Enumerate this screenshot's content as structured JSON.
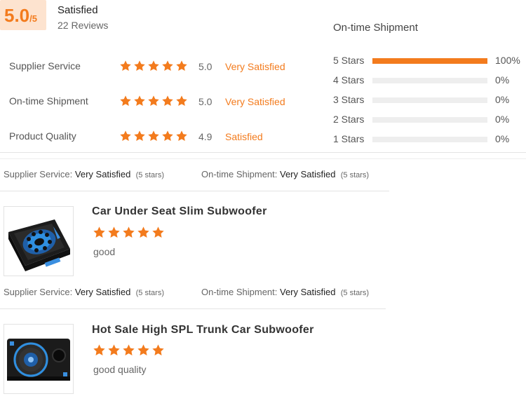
{
  "summary": {
    "score": "5.0",
    "score_out_of": "/5",
    "label": "Satisfied",
    "reviews": "22 Reviews"
  },
  "metrics": [
    {
      "label": "Supplier Service",
      "stars": 5,
      "score": "5.0",
      "text": "Very Satisfied"
    },
    {
      "label": "On-time Shipment",
      "stars": 5,
      "score": "5.0",
      "text": "Very Satisfied"
    },
    {
      "label": "Product Quality",
      "stars": 5,
      "score": "4.9",
      "text": "Satisfied"
    }
  ],
  "distribution": {
    "title": "On-time Shipment",
    "rows": [
      {
        "label": "5 Stars",
        "fraction": 1.0,
        "pct": "100%"
      },
      {
        "label": "4 Stars",
        "fraction": 0.0,
        "pct": "0%"
      },
      {
        "label": "3 Stars",
        "fraction": 0.0,
        "pct": "0%"
      },
      {
        "label": "2 Stars",
        "fraction": 0.0,
        "pct": "0%"
      },
      {
        "label": "1 Stars",
        "fraction": 0.0,
        "pct": "0%"
      }
    ]
  },
  "reviews": [
    {
      "supplier_label": "Supplier Service:",
      "supplier_value": "Very Satisfied",
      "supplier_stars": "(5 stars)",
      "shipment_label": "On-time Shipment:",
      "shipment_value": "Very Satisfied",
      "shipment_stars": "(5 stars)",
      "product_title": "Car Under Seat Slim Subwoofer",
      "stars": 5,
      "text": "good"
    },
    {
      "supplier_label": "Supplier Service:",
      "supplier_value": "Very Satisfied",
      "supplier_stars": "(5 stars)",
      "shipment_label": "On-time Shipment:",
      "shipment_value": "Very Satisfied",
      "shipment_stars": "(5 stars)",
      "product_title": "Hot Sale High SPL Trunk Car Subwoofer",
      "stars": 5,
      "text": "good quality"
    }
  ],
  "colors": {
    "accent": "#f37b1d",
    "badge_bg": "#fde3cf",
    "bar_track": "#eeeeee",
    "divider": "#e4e4e4"
  }
}
